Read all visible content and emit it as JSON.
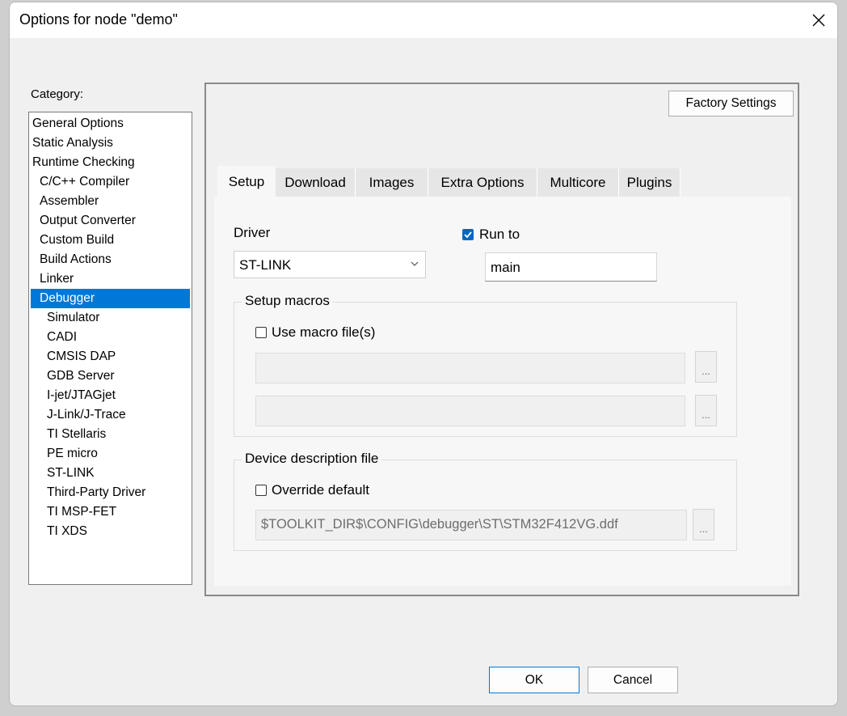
{
  "window": {
    "title": "Options for node \"demo\""
  },
  "sidebar": {
    "label": "Category:",
    "items": [
      {
        "label": "General Options",
        "level": 0
      },
      {
        "label": "Static Analysis",
        "level": 0
      },
      {
        "label": "Runtime Checking",
        "level": 0
      },
      {
        "label": "C/C++ Compiler",
        "level": 1
      },
      {
        "label": "Assembler",
        "level": 1
      },
      {
        "label": "Output Converter",
        "level": 1
      },
      {
        "label": "Custom Build",
        "level": 1
      },
      {
        "label": "Build Actions",
        "level": 1
      },
      {
        "label": "Linker",
        "level": 1
      },
      {
        "label": "Debugger",
        "level": 1,
        "selected": true
      },
      {
        "label": "Simulator",
        "level": 2
      },
      {
        "label": "CADI",
        "level": 2
      },
      {
        "label": "CMSIS DAP",
        "level": 2
      },
      {
        "label": "GDB Server",
        "level": 2
      },
      {
        "label": "I-jet/JTAGjet",
        "level": 2
      },
      {
        "label": "J-Link/J-Trace",
        "level": 2
      },
      {
        "label": "TI Stellaris",
        "level": 2
      },
      {
        "label": "PE micro",
        "level": 2
      },
      {
        "label": "ST-LINK",
        "level": 2
      },
      {
        "label": "Third-Party Driver",
        "level": 2
      },
      {
        "label": "TI MSP-FET",
        "level": 2
      },
      {
        "label": "TI XDS",
        "level": 2
      }
    ]
  },
  "panel": {
    "factory_settings_label": "Factory Settings",
    "tabs": [
      {
        "label": "Setup",
        "active": true
      },
      {
        "label": "Download"
      },
      {
        "label": "Images"
      },
      {
        "label": "Extra Options"
      },
      {
        "label": "Multicore"
      },
      {
        "label": "Plugins"
      }
    ],
    "setup": {
      "driver_label": "Driver",
      "driver_value": "ST-LINK",
      "run_to_label": "Run to",
      "run_to_checked": true,
      "run_to_value": "main",
      "setup_macros": {
        "legend": "Setup macros",
        "use_macro_label": "Use macro file(s)",
        "use_macro_checked": false,
        "browse_label": "..."
      },
      "device_description": {
        "legend": "Device description file",
        "override_label": "Override default",
        "override_checked": false,
        "path": "$TOOLKIT_DIR$\\CONFIG\\debugger\\ST\\STM32F412VG.ddf",
        "browse_label": "..."
      }
    }
  },
  "footer": {
    "ok_label": "OK",
    "cancel_label": "Cancel"
  },
  "colors": {
    "selection": "#0078d7",
    "checkbox_checked": "#0067c0"
  }
}
